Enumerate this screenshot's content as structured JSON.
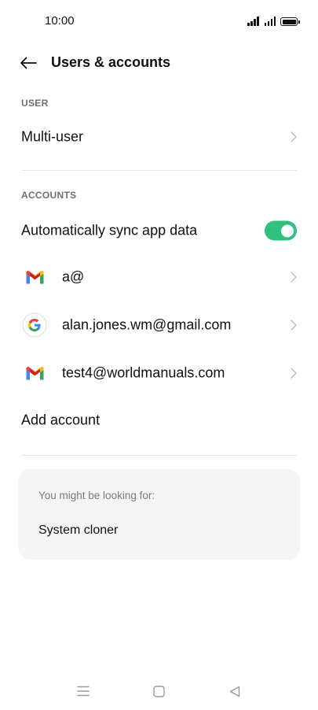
{
  "status_bar": {
    "time": "10:00",
    "icons": [
      "signal-icon",
      "signal-icon",
      "battery-icon"
    ]
  },
  "header": {
    "back_icon": "arrow-left-icon",
    "title": "Users & accounts"
  },
  "user_section": {
    "label": "USER",
    "items": [
      {
        "label": "Multi-user"
      }
    ]
  },
  "accounts_section": {
    "label": "ACCOUNTS",
    "auto_sync": {
      "label": "Automatically sync app data",
      "enabled": true
    },
    "accounts": [
      {
        "icon": "gmail-icon",
        "label": "a@"
      },
      {
        "icon": "google-icon",
        "label": "alan.jones.wm@gmail.com"
      },
      {
        "icon": "gmail-icon",
        "label": "test4@worldmanuals.com"
      }
    ],
    "add_account": {
      "label": "Add account"
    }
  },
  "suggestions": {
    "heading": "You might be looking for:",
    "items": [
      {
        "label": "System cloner"
      }
    ]
  },
  "colors": {
    "toggle_on": "#2ec27e",
    "card_bg": "#f5f5f5",
    "section_label": "#6f6f6f",
    "divider": "#e6e6e6"
  },
  "nav_bar": {
    "icons": [
      "menu-icon",
      "home-square-icon",
      "back-triangle-icon"
    ]
  }
}
